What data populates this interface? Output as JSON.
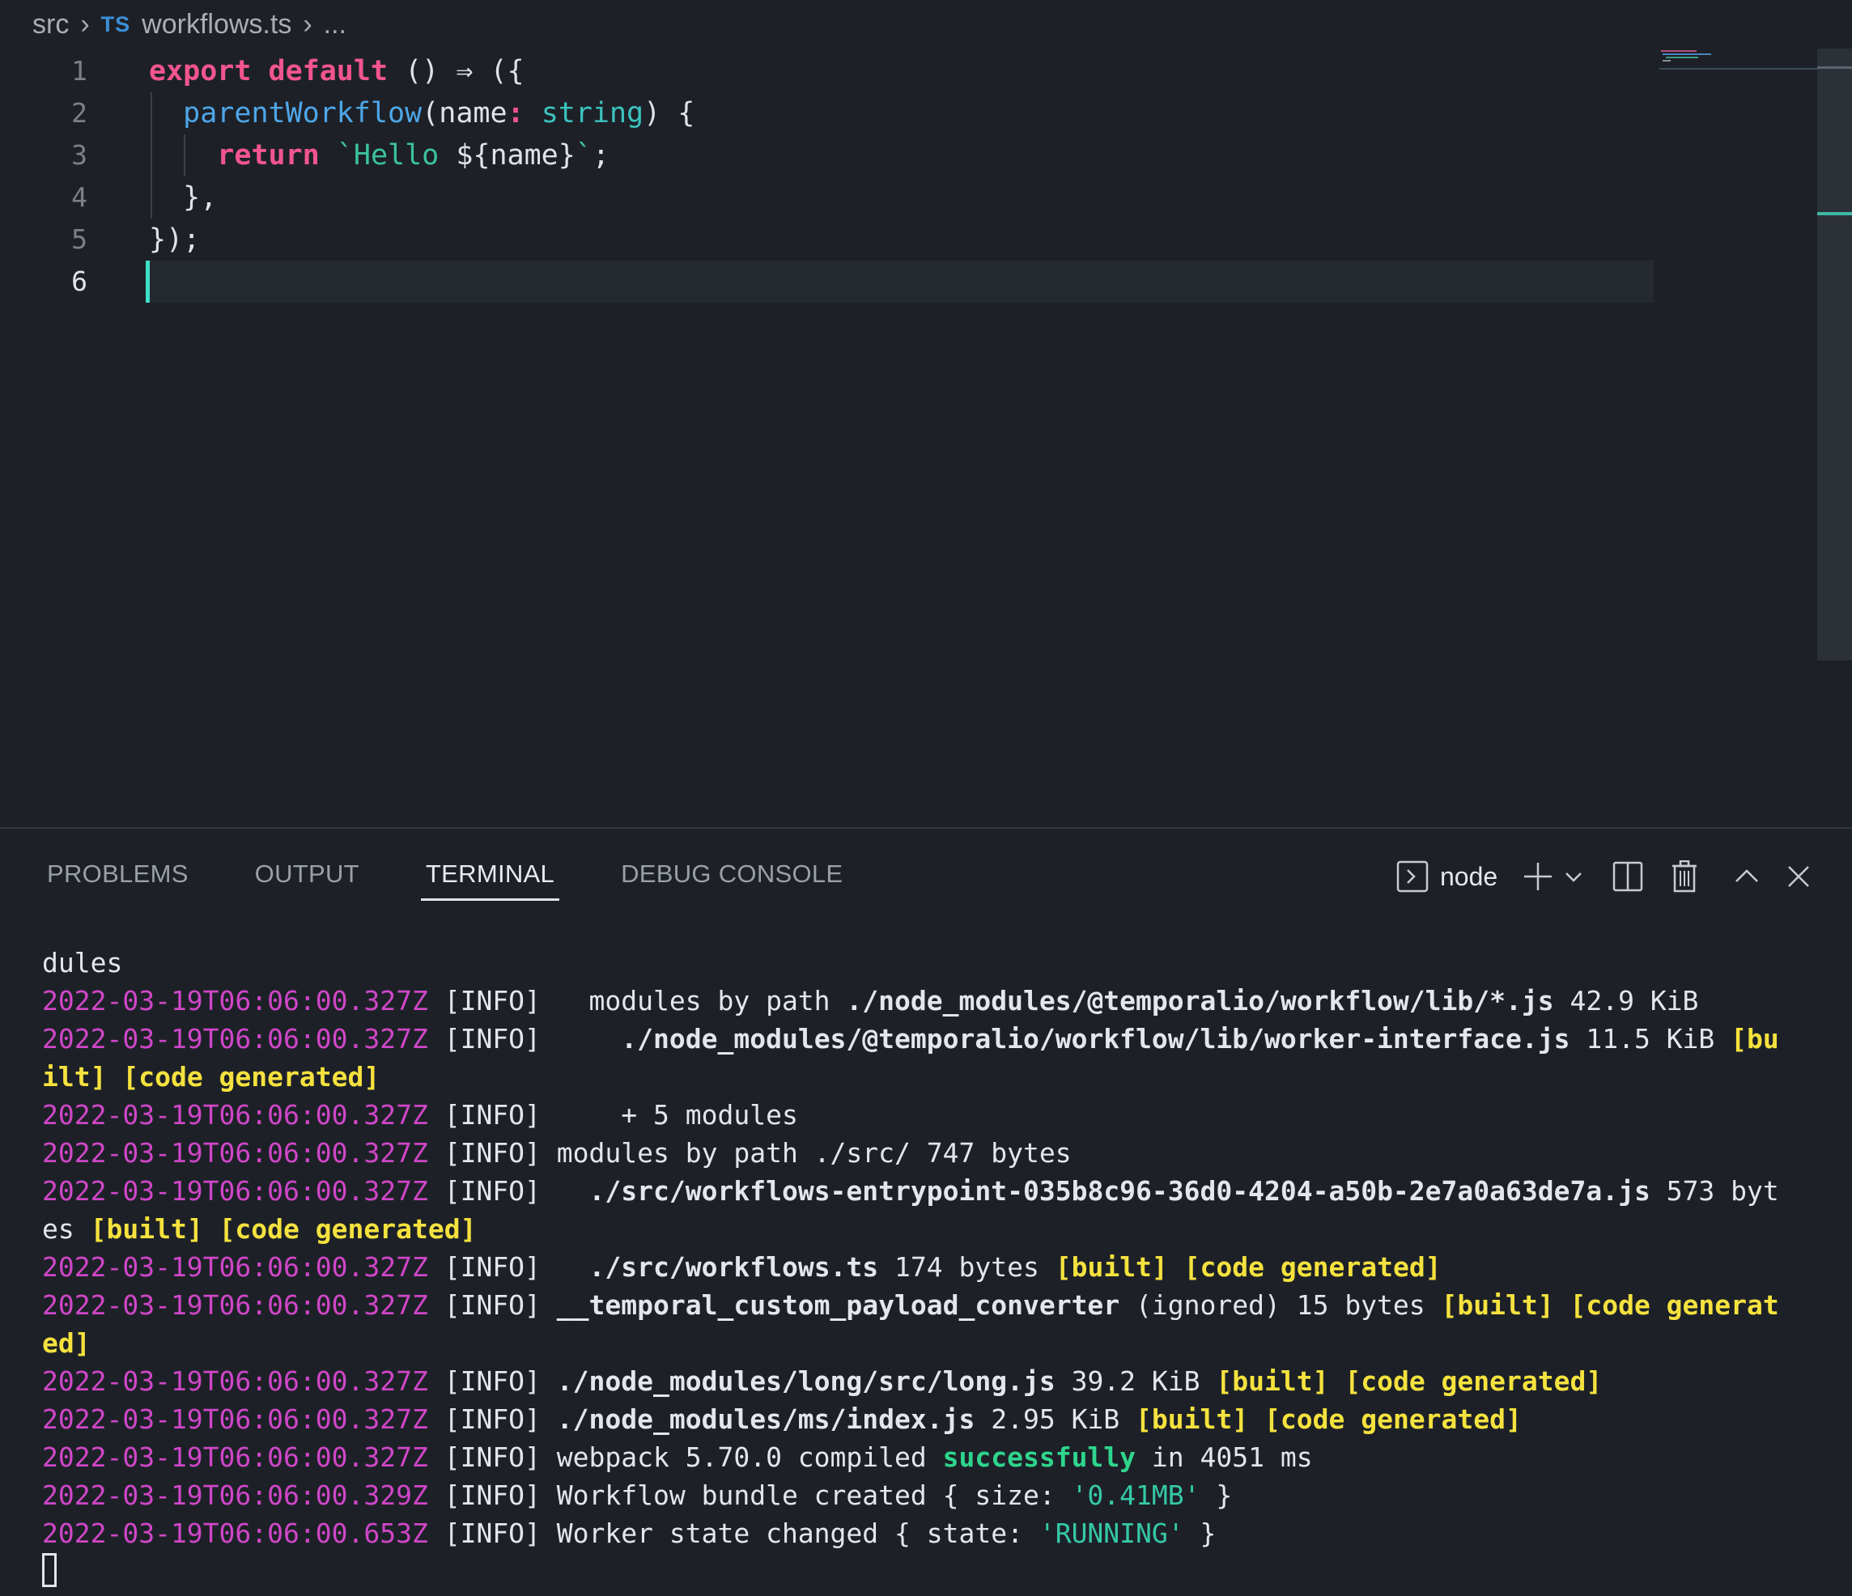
{
  "breadcrumb": {
    "folder": "src",
    "lang_badge": "TS",
    "file": "workflows.ts",
    "more": "..."
  },
  "editor": {
    "line_numbers": [
      "1",
      "2",
      "3",
      "4",
      "5",
      "6"
    ],
    "active_line": "6",
    "code": {
      "l1": {
        "kw1": "export",
        "kw2": "default",
        "rest": "() ⇒ ({"
      },
      "l2": {
        "fn": "parentWorkflow",
        "p1": "(name",
        "colon": ":",
        "ty": "string",
        "p2": ") {"
      },
      "l3": {
        "kw": "return",
        "str1": "`Hello ",
        "tpl": "${name}",
        "str2": "`",
        "semi": ";"
      },
      "l4": {
        "text": "},"
      },
      "l5": {
        "text": "});"
      }
    }
  },
  "panel": {
    "tabs": [
      "PROBLEMS",
      "OUTPUT",
      "TERMINAL",
      "DEBUG CONSOLE"
    ],
    "active_tab": "TERMINAL",
    "terminal_profile": "node",
    "icons": [
      "terminal-icon",
      "plus-icon",
      "chevron-down-icon",
      "split-icon",
      "trash-icon",
      "chevron-up-icon",
      "close-icon"
    ]
  },
  "terminal": {
    "ts": "2022-03-19T06:06:00.327Z",
    "ts2": "2022-03-19T06:06:00.329Z",
    "ts3": "2022-03-19T06:06:00.653Z",
    "lvl": "[INFO]",
    "built": "[built]",
    "gen": "[code generated]",
    "l0": "dules",
    "l1": {
      "pre": "  modules by path ",
      "path": "./node_modules/@temporalio/workflow/lib/*.js",
      "size": " 42.9 KiB"
    },
    "l2": {
      "pre": "    ",
      "path": "./node_modules/@temporalio/workflow/lib/worker-interface.js",
      "size": " 11.5 KiB ",
      "w1": "[bu"
    },
    "l2b": {
      "w1": "ilt]",
      "w2": " [code generated]"
    },
    "l3": "    + 5 modules",
    "l4": "modules by path ./src/ 747 bytes",
    "l5": {
      "pre": "  ",
      "path": "./src/workflows-entrypoint-035b8c96-36d0-4204-a50b-2e7a0a63de7a.js",
      "size": " 573 byt"
    },
    "l5b": {
      "size": "es "
    },
    "l6": {
      "pre": "  ",
      "path": "./src/workflows.ts",
      "size": " 174 bytes "
    },
    "l7": {
      "path": "__temporal_custom_payload_converter",
      "size": " (ignored) 15 bytes ",
      "w2": " [code generat"
    },
    "l7b": "ed]",
    "l8": {
      "path": "./node_modules/long/src/long.js",
      "size": " 39.2 KiB "
    },
    "l9": {
      "path": "./node_modules/ms/index.js",
      "size": " 2.95 KiB "
    },
    "l10": {
      "pre": "webpack 5.70.0 compiled ",
      "ok": "successfully",
      "post": " in 4051 ms"
    },
    "l11": {
      "pre": "Workflow bundle created { size: ",
      "val": "'0.41MB'",
      "post": " }"
    },
    "l12": {
      "pre": "Worker state changed { state: ",
      "val": "'RUNNING'",
      "post": " }"
    }
  },
  "colors": {
    "accent": "#3de0c7",
    "keyword": "#f2558e",
    "function": "#4ea6e8",
    "type": "#3cc3c0",
    "timestamp": "#d046c8",
    "highlight": "#f5e23e",
    "success": "#2fd58d"
  }
}
